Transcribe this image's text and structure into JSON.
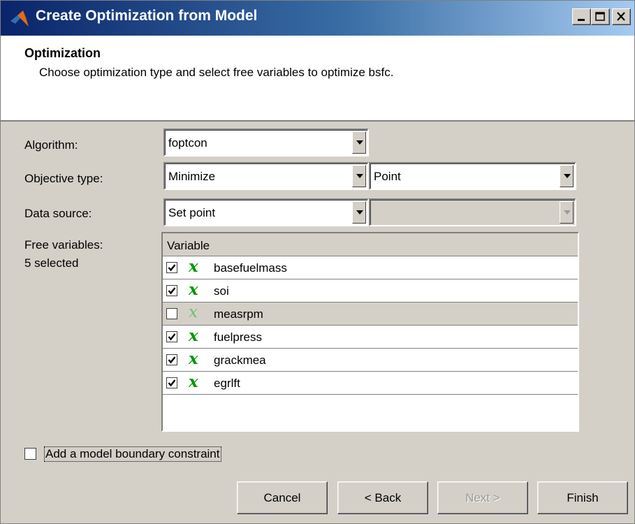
{
  "window": {
    "title": "Create Optimization from Model"
  },
  "header": {
    "title": "Optimization",
    "description": "Choose optimization type and select free variables to optimize bsfc."
  },
  "form": {
    "algorithm_label": "Algorithm:",
    "algorithm_value": "foptcon",
    "objective_label": "Objective type:",
    "objective_value": "Minimize",
    "objective_mode": "Point",
    "datasource_label": "Data source:",
    "datasource_value": "Set point",
    "datasource_second": "",
    "freevars_label": "Free variables:",
    "freevars_count": "5 selected"
  },
  "table": {
    "column": "Variable",
    "rows": [
      {
        "name": "basefuelmass",
        "checked": true,
        "symbol": "x"
      },
      {
        "name": "soi",
        "checked": true,
        "symbol": "x"
      },
      {
        "name": "measrpm",
        "checked": false,
        "symbol": "x"
      },
      {
        "name": "fuelpress",
        "checked": true,
        "symbol": "x"
      },
      {
        "name": "grackmea",
        "checked": true,
        "symbol": "x"
      },
      {
        "name": "egrlft",
        "checked": true,
        "symbol": "x"
      }
    ]
  },
  "boundary": {
    "label": "Add a model boundary constraint",
    "checked": false
  },
  "buttons": {
    "cancel": "Cancel",
    "back": "< Back",
    "next": "Next >",
    "finish": "Finish"
  },
  "colors": {
    "titlebar_start": "#0a246a",
    "titlebar_end": "#a6caf0",
    "variable_icon": "#009900",
    "dialog_bg": "#d4d0c8"
  },
  "icons": {
    "app": "matlab-logo-icon",
    "minimize": "minimize-icon",
    "maximize": "maximize-icon",
    "close": "close-icon",
    "dropdown": "chevron-down-icon",
    "variable": "variable-x-icon",
    "check": "checkmark-icon"
  }
}
